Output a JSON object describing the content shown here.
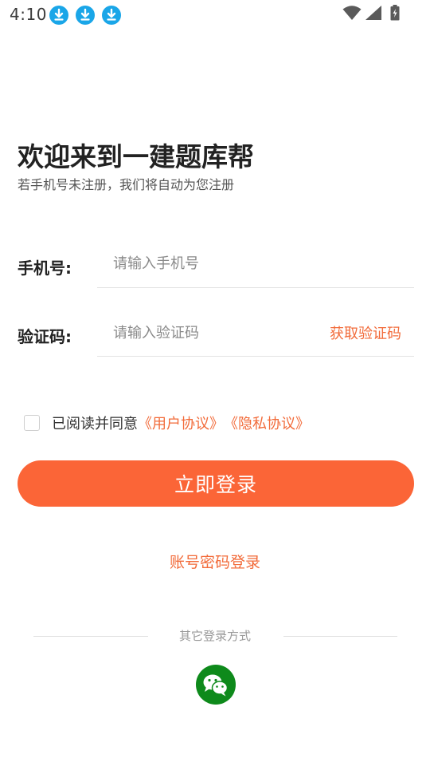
{
  "status_bar": {
    "time": "4:10",
    "notification_icons": [
      "download-icon",
      "download-icon",
      "download-icon"
    ],
    "system_icons": [
      "wifi-icon",
      "signal-icon",
      "battery-charging-icon"
    ]
  },
  "header": {
    "title": "欢迎来到一建题库帮",
    "subtitle": "若手机号未注册，我们将自动为您注册"
  },
  "form": {
    "phone": {
      "label": "手机号:",
      "placeholder": "请输入手机号",
      "value": ""
    },
    "code": {
      "label": "验证码:",
      "placeholder": "请输入验证码",
      "value": "",
      "get_code_label": "获取验证码"
    }
  },
  "agreement": {
    "checked": false,
    "prefix": "已阅读并同意",
    "user_agreement": "《用户协议》",
    "privacy_policy": "《隐私协议》"
  },
  "login_button_label": "立即登录",
  "password_login_label": "账号密码登录",
  "other_login": {
    "label": "其它登录方式",
    "methods": [
      "wechat-icon"
    ]
  },
  "colors": {
    "accent": "#fb6537",
    "link": "#f26b3a",
    "wechat": "#0e8a1b",
    "download_badge": "#1aa6e8"
  }
}
